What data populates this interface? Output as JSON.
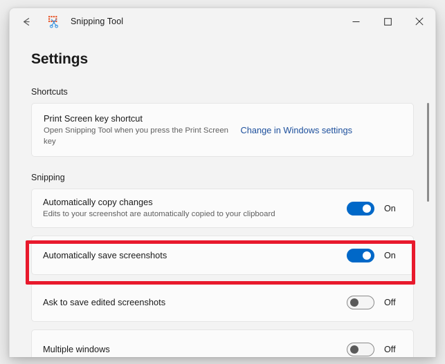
{
  "window": {
    "title": "Snipping Tool",
    "back_label": "Back",
    "app_icon": "snipping-tool-icon",
    "controls": {
      "minimize": "Minimize",
      "maximize": "Maximize",
      "close": "Close"
    }
  },
  "page": {
    "title": "Settings"
  },
  "sections": [
    {
      "label": "Shortcuts"
    },
    {
      "label": "Snipping"
    }
  ],
  "shortcuts": {
    "print_screen": {
      "title": "Print Screen key shortcut",
      "description": "Open Snipping Tool when you press the Print Screen key",
      "link": "Change in Windows settings"
    }
  },
  "snipping": {
    "rows": [
      {
        "title": "Automatically copy changes",
        "description": "Edits to your screenshot are automatically copied to your clipboard",
        "state": "On",
        "on": true
      },
      {
        "title": "Automatically save screenshots",
        "description": "",
        "state": "On",
        "on": true
      },
      {
        "title": "Ask to save edited screenshots",
        "description": "",
        "state": "Off",
        "on": false
      },
      {
        "title": "Multiple windows",
        "description": "",
        "state": "Off",
        "on": false
      }
    ]
  },
  "annotation": {
    "highlight_color": "#e8192c",
    "highlight_target": "Automatically save screenshots"
  },
  "colors": {
    "accent": "#0068c8",
    "link": "#1c4f9c",
    "window_background": "#f3f3f3",
    "card_background": "#fbfbfb",
    "card_border": "#e5e5e5"
  }
}
